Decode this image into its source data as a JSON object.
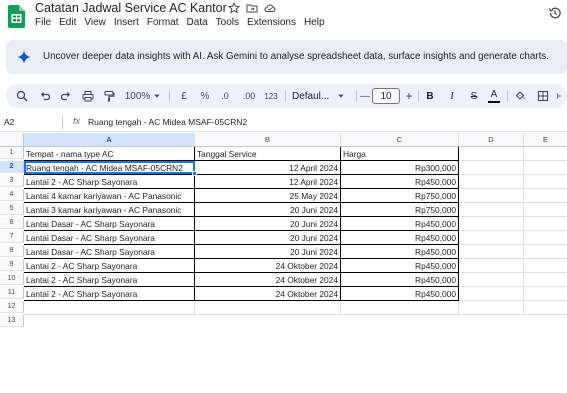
{
  "app": {
    "title": "Catatan Jadwal Service AC Kantor",
    "menu": [
      "File",
      "Edit",
      "View",
      "Insert",
      "Format",
      "Data",
      "Tools",
      "Extensions",
      "Help"
    ]
  },
  "banner": {
    "text": "Uncover deeper data insights with AI.  Ask Gemini to analyse spreadsheet data, surface insights and generate charts."
  },
  "toolbar": {
    "zoom": "100%",
    "currency": "£",
    "percent": "%",
    "decimal_decrease": ".0",
    "decimal_increase": ".00",
    "number_format": "123",
    "font": "Defaul...",
    "font_size": "10",
    "bold": "B",
    "italic": "I",
    "strike": "S",
    "text_color": "A",
    "minus": "—",
    "plus": "+"
  },
  "formula_bar": {
    "name_box": "A2",
    "fx": "fx",
    "content": "Ruang tengah - AC Midea MSAF-05CRN2"
  },
  "sheet": {
    "columns": [
      "A",
      "B",
      "C",
      "D",
      "E"
    ],
    "row_numbers": [
      "1",
      "2",
      "3",
      "4",
      "5",
      "6",
      "7",
      "8",
      "9",
      "10",
      "11",
      "12",
      "13"
    ],
    "header": {
      "a": "Tempat - nama type AC",
      "b": "Tanggal Service",
      "c": "Harga"
    },
    "rows": [
      {
        "a": "Ruang tengah - AC Midea MSAF-05CRN2",
        "b": "12 April 2024",
        "c": "Rp300,000"
      },
      {
        "a": "Lantai 2 - AC Sharp Sayonara",
        "b": "12 April 2024",
        "c": "Rp450,000"
      },
      {
        "a": "Lantai 4 kamar kariyawan - AC Panasonic",
        "b": "25 May 2024",
        "c": "Rp750,000"
      },
      {
        "a": "Lantai 3 kamar kariyawan - AC Panasonic",
        "b": "20 Juni 2024",
        "c": "Rp750,000"
      },
      {
        "a": "Lantai Dasar - AC Sharp Sayonara",
        "b": "20 Juni 2024",
        "c": "Rp450,000"
      },
      {
        "a": "Lantai Dasar - AC Sharp Sayonara",
        "b": "20 Juni 2024",
        "c": "Rp450,000"
      },
      {
        "a": "Lantai Dasar - AC Sharp Sayonara",
        "b": "20 Juni 2024",
        "c": "Rp450,000"
      },
      {
        "a": "Lantai 2 - AC Sharp Sayonara",
        "b": "24 Oktober 2024",
        "c": "Rp450,000"
      },
      {
        "a": "Lantai 2 - AC Sharp Sayonara",
        "b": "24 Oktober 2024",
        "c": "Rp450,000"
      },
      {
        "a": "Lantai 2 - AC Sharp Sayonara",
        "b": "24 Oktober 2024",
        "c": "Rp450,000"
      }
    ]
  },
  "colors": {
    "accent": "#1a73e8",
    "banner_bg": "#e9eef6",
    "toolbar_bg": "#edf2fa",
    "selected_header": "#d3e3fd",
    "sheets_green": "#0f9d58"
  }
}
